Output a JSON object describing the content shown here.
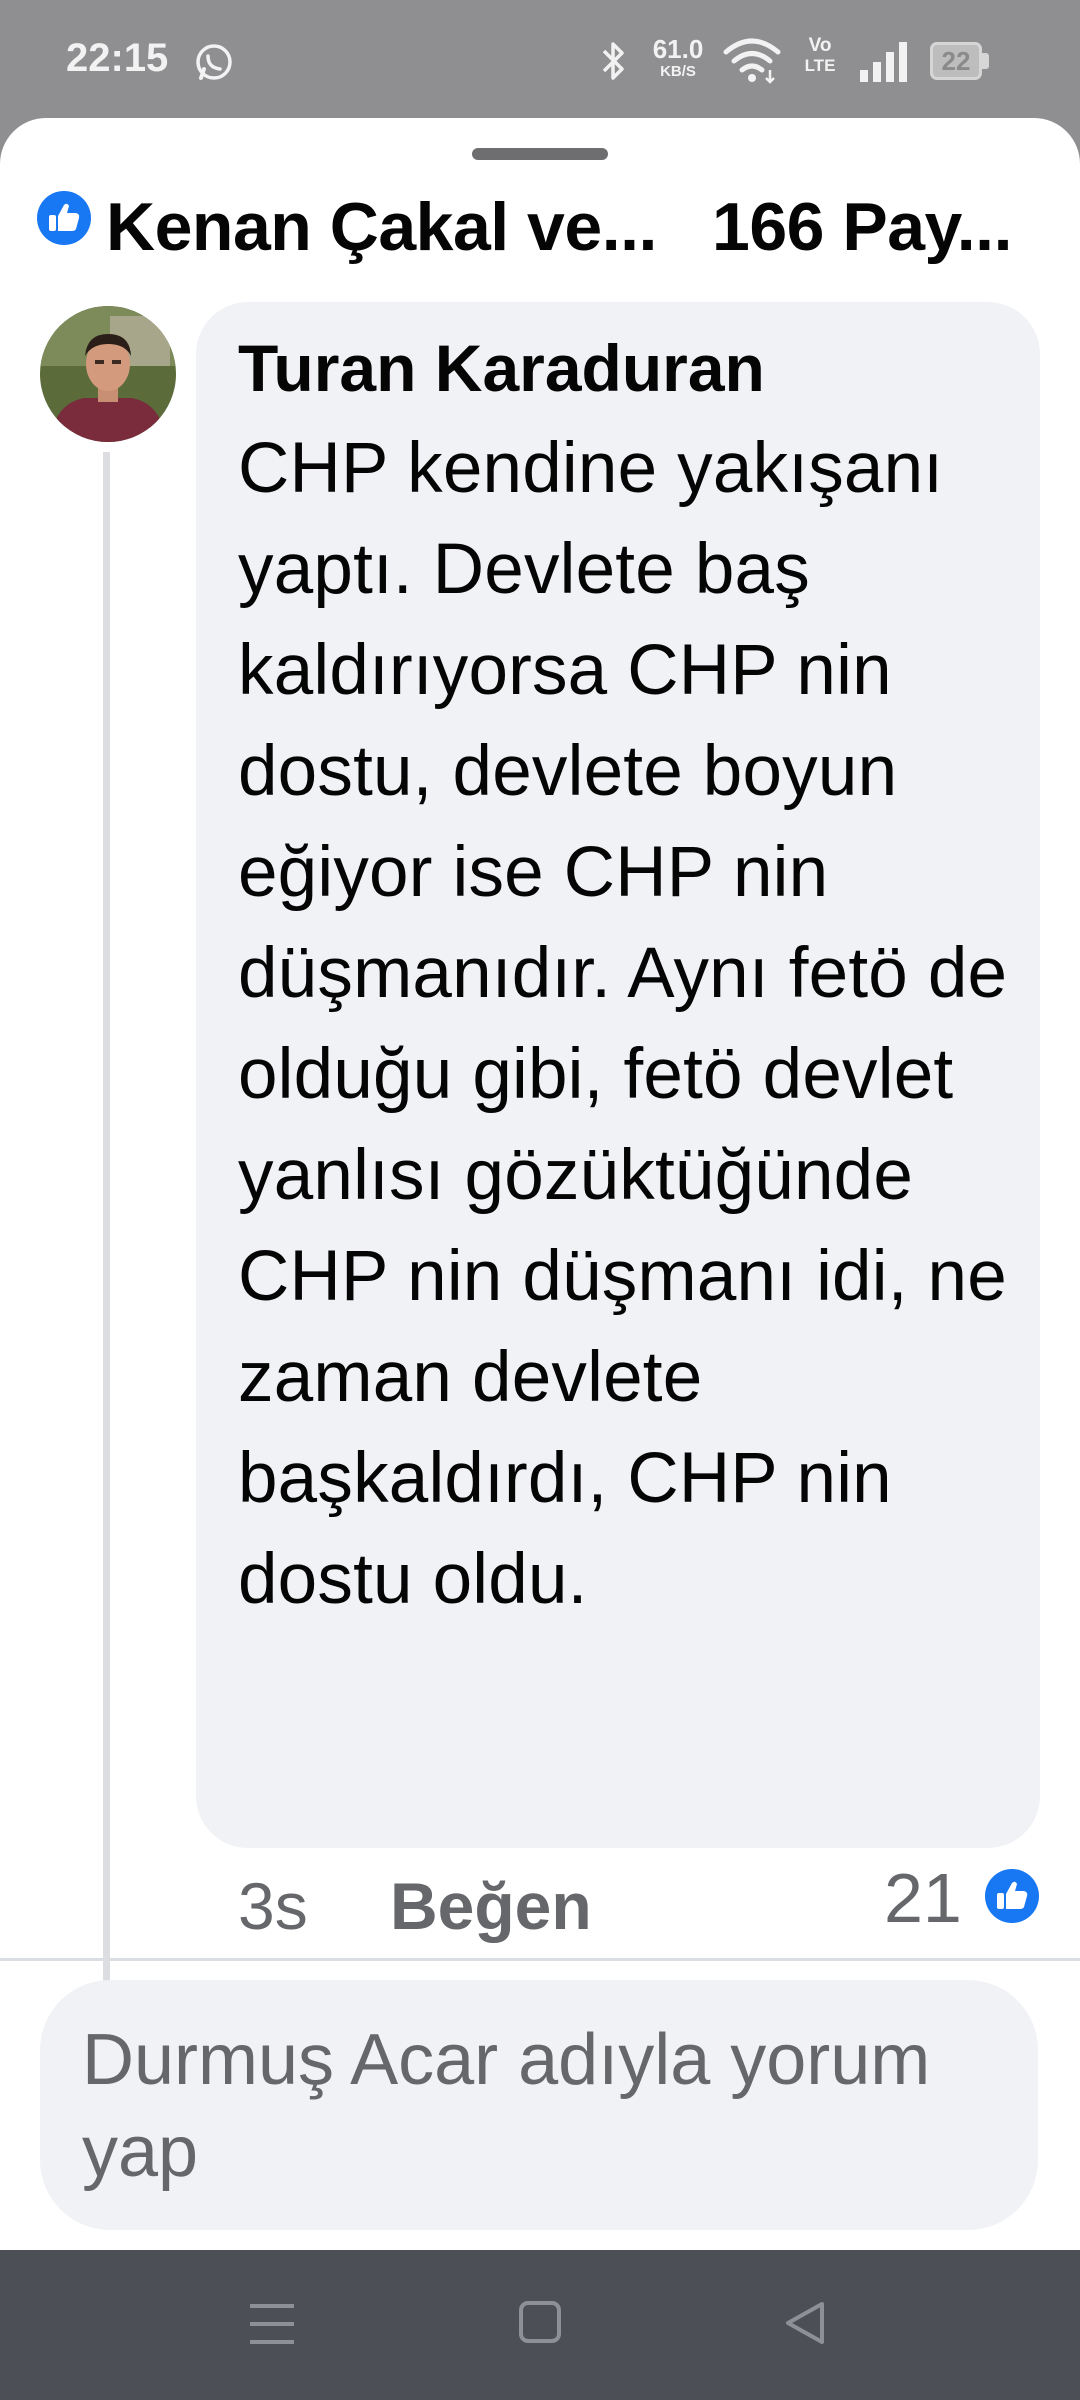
{
  "status_bar": {
    "time": "22:15",
    "net_speed_value": "61.0",
    "net_speed_unit": "KB/S",
    "volte_top": "Vo",
    "volte_bottom": "LTE",
    "battery_level": "22",
    "icons": [
      "whatsapp-icon",
      "bluetooth-icon",
      "wifi-icon",
      "signal-icon",
      "battery-icon"
    ]
  },
  "header": {
    "title": "Kenan Çakal ve...",
    "shares": "166 Pay...",
    "reaction_icon": "like-icon"
  },
  "comment": {
    "author": "Turan Karaduran",
    "text": "CHP kendine yakışanı yaptı. Devlete baş kaldırıyorsa CHP nin dostu, devlete boyun eğiyor ise CHP nin düşmanıdır. Aynı fetö de olduğu gibi, fetö devlet yanlısı gözüktüğünde CHP nin düşmanı idi, ne zaman devlete başkaldırdı, CHP nin dostu oldu.",
    "time": "3s",
    "like_label": "Beğen",
    "reaction_count": "21"
  },
  "composer": {
    "placeholder": "Durmuş Acar adıyla yorum yap"
  },
  "colors": {
    "facebook_blue": "#1877f2",
    "bubble_bg": "#f0f2f5",
    "secondary_text": "#65676b",
    "nav_bar": "#4d4f56"
  }
}
